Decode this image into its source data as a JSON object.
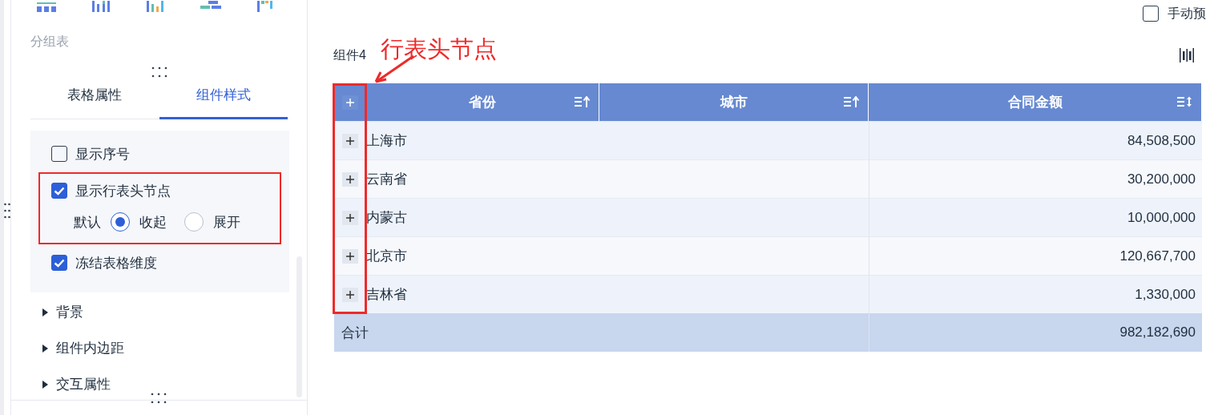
{
  "panel": {
    "group_label": "分组表",
    "tabs": [
      {
        "label": "表格属性",
        "selected": false
      },
      {
        "label": "组件样式",
        "selected": true
      }
    ],
    "options": [
      {
        "kind": "checkbox",
        "label": "显示序号",
        "checked": false,
        "highlighted": false
      },
      {
        "kind": "checkbox",
        "label": "显示行表头节点",
        "checked": true,
        "highlighted": true,
        "sub": {
          "label": "默认",
          "choices": [
            {
              "label": "收起",
              "selected": true
            },
            {
              "label": "展开",
              "selected": false
            }
          ]
        }
      },
      {
        "kind": "checkbox",
        "label": "冻结表格维度",
        "checked": true,
        "highlighted": false
      }
    ],
    "sections": [
      {
        "label": "背景",
        "expanded": false
      },
      {
        "label": "组件内边距",
        "expanded": false
      },
      {
        "label": "交互属性",
        "expanded": false
      }
    ]
  },
  "manual_preview": {
    "label": "手动预",
    "checked": false
  },
  "component": {
    "title": "组件4",
    "annotation": "行表头节点",
    "table": {
      "header_expanded": false,
      "columns": [
        {
          "label": "省份",
          "kind": "asc"
        },
        {
          "label": "城市",
          "kind": "asc"
        },
        {
          "label": "合同金额",
          "kind": "both"
        }
      ],
      "rows": [
        {
          "province": "上海市",
          "amount": "84,508,500",
          "expanded": false
        },
        {
          "province": "云南省",
          "amount": "30,200,000",
          "expanded": false
        },
        {
          "province": "内蒙古",
          "amount": "10,000,000",
          "expanded": false
        },
        {
          "province": "北京市",
          "amount": "120,667,700",
          "expanded": false
        },
        {
          "province": "吉林省",
          "amount": "1,330,000",
          "expanded": false
        }
      ],
      "total": {
        "label": "合计",
        "amount": "982,182,690"
      }
    }
  }
}
